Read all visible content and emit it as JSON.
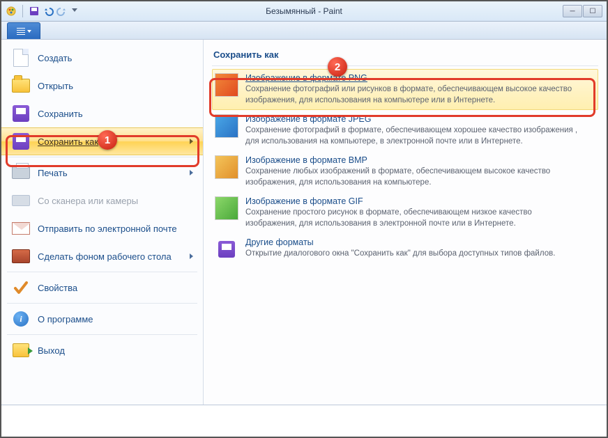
{
  "title": "Безымянный - Paint",
  "left": {
    "new": "Создать",
    "open": "Открыть",
    "save": "Сохранить",
    "saveas": "Сохранить как",
    "print": "Печать",
    "scanner": "Со сканера или камеры",
    "email": "Отправить по электронной почте",
    "desktop": "Сделать фоном рабочего стола",
    "props": "Свойства",
    "about": "О программе",
    "exit": "Выход"
  },
  "right": {
    "header": "Сохранить как",
    "items": [
      {
        "title": "Изображение в формате PNG",
        "desc": "Сохранение фотографий или рисунков в формате, обеспечивающем высокое качество изображения, для использования на компьютере или в Интернете."
      },
      {
        "title": "Изображение в формате JPEG",
        "desc": "Сохранение фотографий в формате, обеспечивающем хорошее качество изображения , для использования на компьютере, в электронной почте или в Интернете."
      },
      {
        "title": "Изображение в формате BMP",
        "desc": "Сохранение любых изображений в формате, обеспечивающем высокое качество изображения, для использования на компьютере."
      },
      {
        "title": "Изображение в формате GIF",
        "desc": "Сохранение простого рисунок в формате, обеспечивающем низкое качество изображения, для использования в электронной почте или в Интернете."
      },
      {
        "title": "Другие форматы",
        "desc": "Открытие диалогового окна \"Сохранить как\" для выбора доступных типов файлов."
      }
    ]
  },
  "badges": {
    "b1": "1",
    "b2": "2"
  }
}
